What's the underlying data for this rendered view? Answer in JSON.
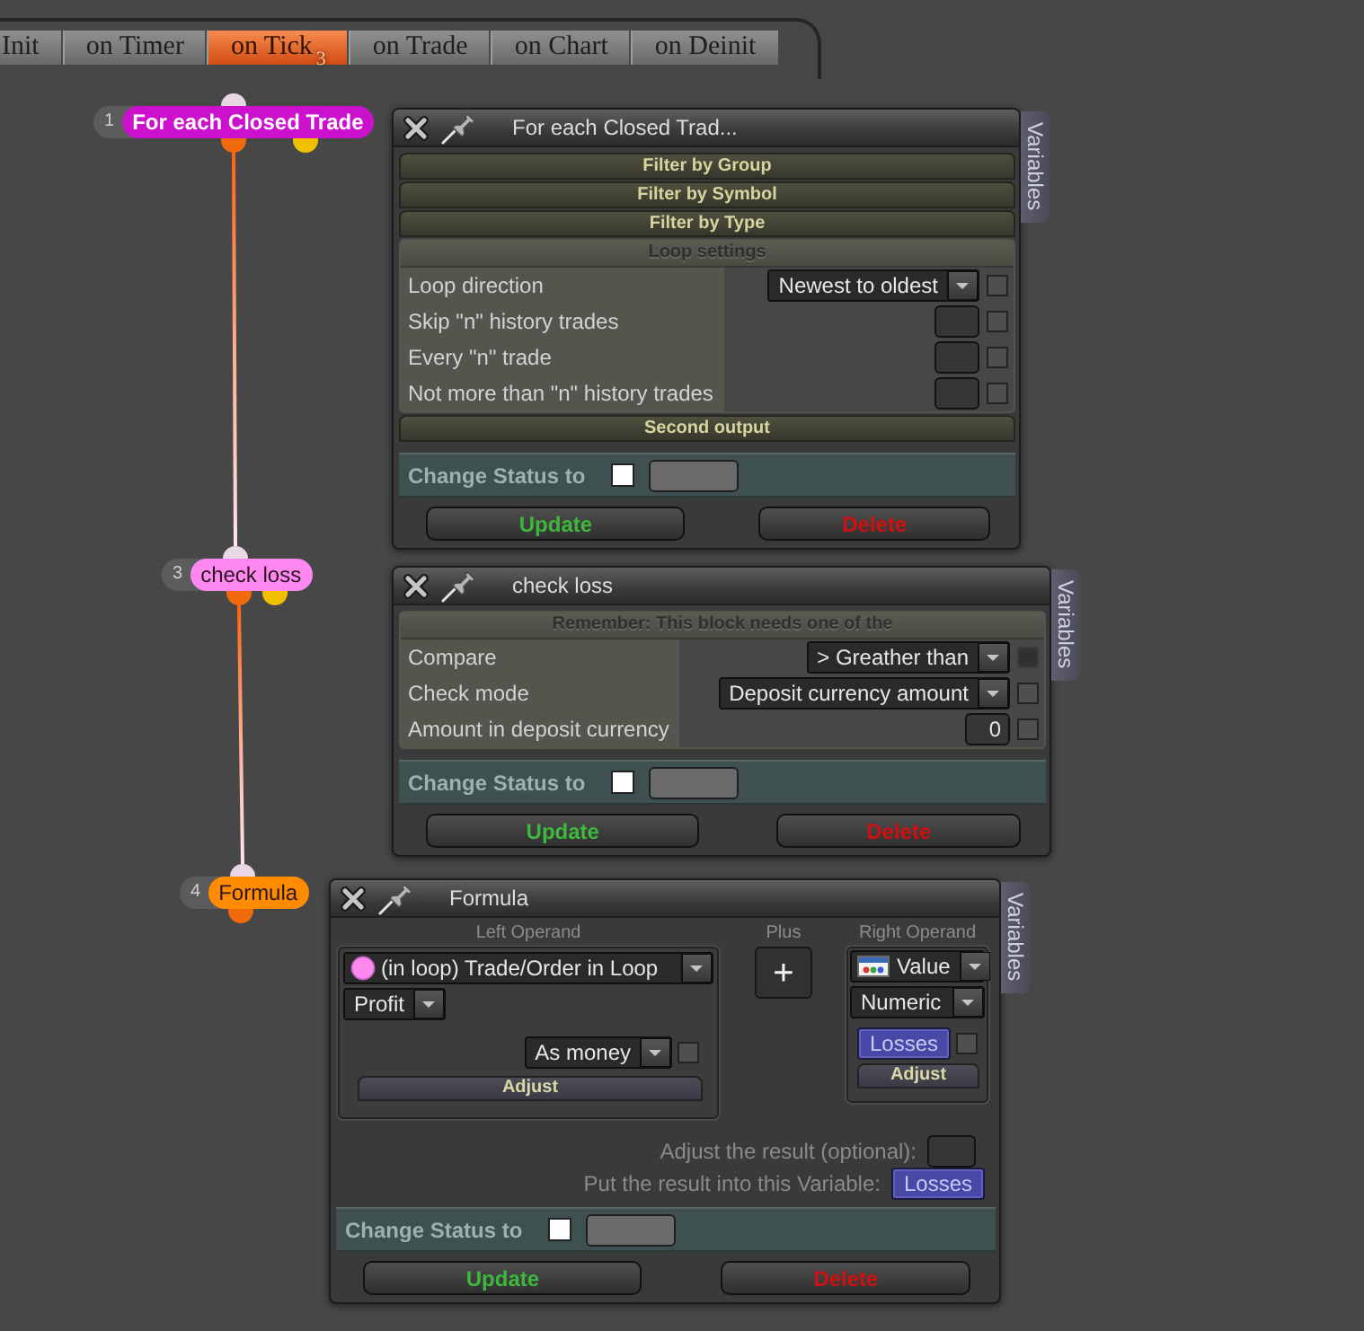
{
  "tabs": [
    {
      "label": "Init",
      "selected": false
    },
    {
      "label": "on Timer",
      "selected": false
    },
    {
      "label": "on Tick",
      "selected": true,
      "badge": "3"
    },
    {
      "label": "on Trade",
      "selected": false
    },
    {
      "label": "on Chart",
      "selected": false
    },
    {
      "label": "on Deinit",
      "selected": false
    }
  ],
  "nodes": [
    {
      "number": "1",
      "label": "For each Closed Trade",
      "color": "#cc11cc",
      "second_output": true
    },
    {
      "number": "3",
      "label": "check loss",
      "color": "#ff88f0",
      "second_output": true
    },
    {
      "number": "4",
      "label": "Formula",
      "color": "#ff8c00",
      "second_output": false
    }
  ],
  "panels": [
    {
      "kind": "settings",
      "title": "For each Closed Trad...",
      "side_tab": "Variables",
      "sections": [
        {
          "kind": "header",
          "label": "Filter by Group"
        },
        {
          "kind": "header",
          "label": "Filter by Symbol"
        },
        {
          "kind": "header",
          "label": "Filter by Type"
        },
        {
          "kind": "group",
          "label": "Loop settings",
          "rows": [
            {
              "kind": "dropdown",
              "label": "Loop direction",
              "value": "Newest to oldest",
              "checked": false,
              "disabled": false
            },
            {
              "kind": "input",
              "label": "Skip \"n\" history trades",
              "checked": false,
              "disabled": false
            },
            {
              "kind": "input",
              "label": "Every \"n\" trade",
              "checked": false,
              "disabled": false
            },
            {
              "kind": "input",
              "label": "Not more than \"n\" history trades",
              "checked": false,
              "disabled": false
            }
          ]
        },
        {
          "kind": "header",
          "label": "Second output"
        }
      ],
      "status": {
        "label": "Change Status to",
        "checked": false
      },
      "buttons": [
        {
          "kind": "update",
          "label": "Update"
        },
        {
          "kind": "delete",
          "label": "Delete"
        }
      ]
    },
    {
      "kind": "settings",
      "title": "check loss",
      "side_tab": "Variables",
      "sections": [
        {
          "kind": "group",
          "label": "Remember: This block needs one of the",
          "rows": [
            {
              "kind": "dropdown",
              "label": "Compare",
              "value": "> Greather than",
              "checked": false,
              "disabled": true
            },
            {
              "kind": "dropdown",
              "label": "Check mode",
              "value": "Deposit currency amount",
              "checked": false,
              "disabled": false
            },
            {
              "kind": "input",
              "label": "Amount in deposit currency",
              "value": "0",
              "checked": false,
              "disabled": false
            }
          ]
        }
      ],
      "status": {
        "label": "Change Status to",
        "checked": false
      },
      "buttons": [
        {
          "kind": "update",
          "label": "Update"
        },
        {
          "kind": "delete",
          "label": "Delete"
        }
      ]
    },
    {
      "kind": "formula",
      "title": "Formula",
      "side_tab": "Variables",
      "formula": {
        "left": {
          "label": "Left Operand",
          "source": "(in loop) Trade/Order in Loop",
          "field": "Profit",
          "format": "As money",
          "format_checked": false,
          "adjust": "Adjust"
        },
        "operator": {
          "label": "Plus",
          "symbol": "+"
        },
        "right": {
          "label": "Right Operand",
          "type": "Value",
          "subtype": "Numeric",
          "variable": "Losses",
          "variable_checked": false,
          "adjust": "Adjust"
        },
        "result_adjust": {
          "label": "Adjust the result (optional):"
        },
        "result_variable": {
          "label": "Put the result into this Variable:",
          "value": "Losses"
        }
      },
      "status": {
        "label": "Change Status to",
        "checked": false
      },
      "buttons": [
        {
          "kind": "update",
          "label": "Update"
        },
        {
          "kind": "delete",
          "label": "Delete"
        }
      ]
    }
  ]
}
